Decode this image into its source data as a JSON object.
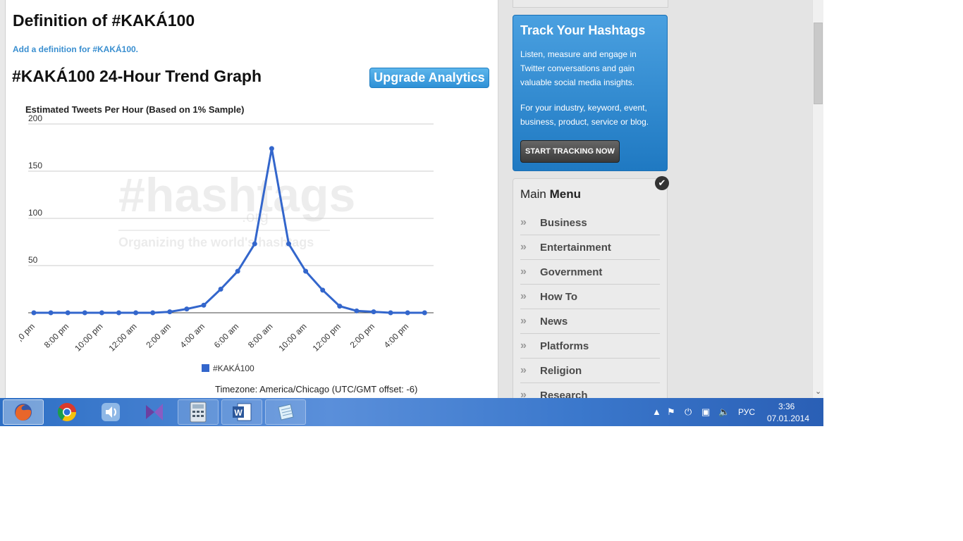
{
  "page": {
    "definition_title": "Definition of #KAKÁ100",
    "add_definition_link": "Add a definition for #KAKÁ100.",
    "trend_title": "#KAKÁ100 24-Hour Trend Graph",
    "upgrade_button": "Upgrade Analytics"
  },
  "chart_data": {
    "type": "line",
    "title": "Estimated Tweets Per Hour (Based on 1% Sample)",
    "xlabel": "",
    "ylabel": "",
    "ylim": [
      0,
      200
    ],
    "yticks": [
      50,
      100,
      150,
      200
    ],
    "x_tick_labels": [
      ",0 pm",
      "8:00 pm",
      "10:00 pm",
      "12:00 am",
      "2:00 am",
      "4:00 am",
      "6:00 am",
      "8:00 am",
      "10:00 am",
      "12:00 pm",
      "2:00 pm",
      "4:00 pm"
    ],
    "series": [
      {
        "name": "#KAKÁ100",
        "color": "#3366cc",
        "values": [
          0,
          0,
          0,
          0,
          0,
          0,
          0,
          0,
          1,
          4,
          8,
          25,
          44,
          73,
          174,
          73,
          44,
          24,
          7,
          2,
          1,
          0,
          0,
          0
        ]
      }
    ],
    "legend": "bottom",
    "grid": true,
    "watermark": {
      "main": "#hashtags",
      "sub": ".org",
      "tagline": "Organizing the world's hashtags"
    },
    "footer": "Timezone: America/Chicago (UTC/GMT offset: -6)"
  },
  "sidebar": {
    "track": {
      "title": "Track Your Hashtags",
      "p1": "Listen, measure and engage in Twitter conversations and gain valuable social media insights.",
      "p2": "For your industry, keyword, event, business, product, service or blog.",
      "button": "START TRACKING NOW"
    },
    "menu": {
      "title_light": "Main",
      "title_bold": "Menu",
      "items": [
        {
          "label": "Business"
        },
        {
          "label": "Entertainment"
        },
        {
          "label": "Government"
        },
        {
          "label": "How To"
        },
        {
          "label": "News"
        },
        {
          "label": "Platforms"
        },
        {
          "label": "Religion"
        },
        {
          "label": "Research"
        }
      ]
    }
  },
  "taskbar": {
    "apps": [
      {
        "name": "firefox",
        "icon": "firefox-icon",
        "active": true
      },
      {
        "name": "chrome",
        "icon": "chrome-icon"
      },
      {
        "name": "sound",
        "icon": "speaker-app-icon"
      },
      {
        "name": "visual-studio",
        "icon": "visual-studio-icon"
      },
      {
        "name": "calculator",
        "icon": "calculator-icon"
      },
      {
        "name": "word",
        "icon": "word-icon"
      },
      {
        "name": "notepad",
        "icon": "notepad-icon"
      }
    ],
    "tray": {
      "lang": "РУС",
      "time": "3:36",
      "date": "07.01.2014"
    }
  }
}
